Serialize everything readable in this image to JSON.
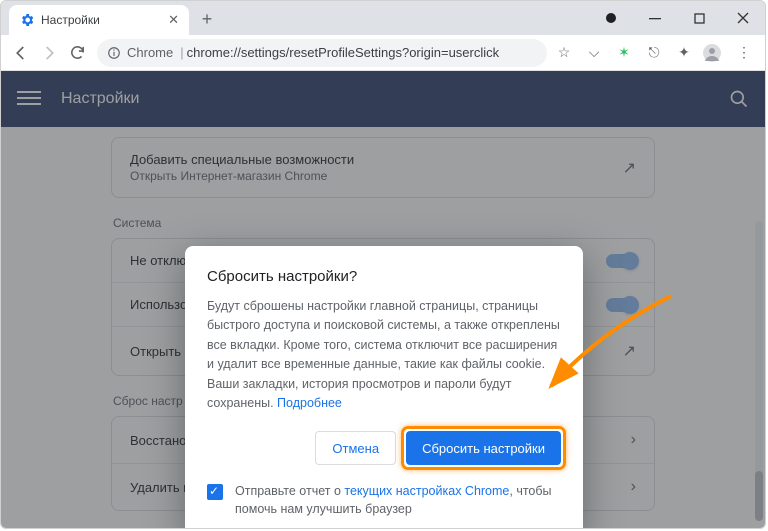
{
  "tab": {
    "title": "Настройки"
  },
  "url": {
    "scheme": "Chrome",
    "path": "chrome://settings/resetProfileSettings?origin=userclick"
  },
  "header": {
    "title": "Настройки"
  },
  "accessibility": {
    "title": "Добавить специальные возможности",
    "sub": "Открыть Интернет-магазин Chrome"
  },
  "system": {
    "section": "Система",
    "row1": "Не отключ",
    "row2": "Использо",
    "row3": "Открыть н"
  },
  "reset": {
    "section": "Сброс настр",
    "row1": "Восстановление настроек по умолчанию",
    "row2": "Удалить вредоносное ПО с компьютера"
  },
  "dialog": {
    "title": "Сбросить настройки?",
    "body": "Будут сброшены настройки главной страницы, страницы быстрого доступа и поисковой системы, а также откреплены все вкладки. Кроме того, система отключит все расширения и удалит все временные данные, такие как файлы cookie. Ваши закладки, история просмотров и пароли будут сохранены. ",
    "learn_more": "Подробнее",
    "cancel": "Отмена",
    "confirm": "Сбросить настройки",
    "helper_pre": "Отправьте отчет о ",
    "helper_link": "текущих настройках Chrome",
    "helper_post": ", чтобы помочь нам улучшить браузер"
  }
}
